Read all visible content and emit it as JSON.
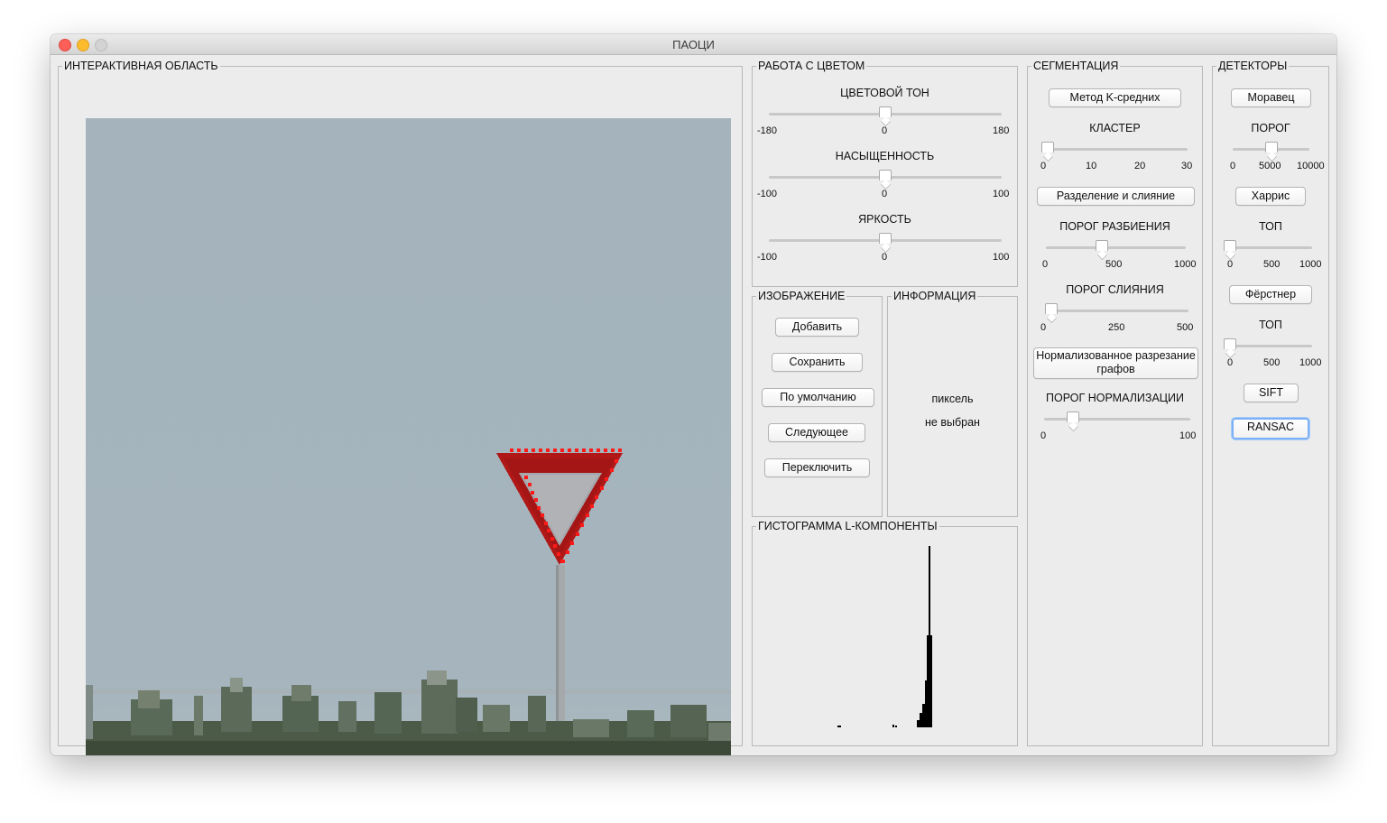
{
  "window": {
    "title": "ПАОЦИ"
  },
  "interactive": {
    "title": "ИНТЕРАКТИВНАЯ ОБЛАСТЬ"
  },
  "color": {
    "title": "РАБОТА С ЦВЕТОМ",
    "hue": {
      "label": "ЦВЕТОВОЙ ТОН",
      "min": "-180",
      "mid": "0",
      "max": "180",
      "value": 0,
      "range": [
        -180,
        180
      ]
    },
    "saturation": {
      "label": "НАСЫЩЕННОСТЬ",
      "min": "-100",
      "mid": "0",
      "max": "100",
      "value": 0,
      "range": [
        -100,
        100
      ]
    },
    "brightness": {
      "label": "ЯРКОСТЬ",
      "min": "-100",
      "mid": "0",
      "max": "100",
      "value": 0,
      "range": [
        -100,
        100
      ]
    }
  },
  "image": {
    "title": "ИЗОБРАЖЕНИЕ",
    "buttons": [
      "Добавить",
      "Сохранить",
      "По умолчанию",
      "Следующее",
      "Переключить"
    ]
  },
  "info": {
    "title": "ИНФОРМАЦИЯ",
    "line1": "пиксель",
    "line2": "не выбран"
  },
  "histogram": {
    "title": "ГИСТОГРАММА L-КОМПОНЕНТЫ"
  },
  "segmentation": {
    "title": "СЕГМЕНТАЦИЯ",
    "kmeans_button": "Метод K-средних",
    "cluster": {
      "label": "КЛАСТЕР",
      "ticks": [
        "0",
        "10",
        "20",
        "30"
      ],
      "value": 0,
      "range": [
        0,
        30
      ]
    },
    "split_merge_button": "Разделение и слияние",
    "split_threshold": {
      "label": "ПОРОГ РАЗБИЕНИЯ",
      "ticks": [
        "0",
        "500",
        "1000"
      ],
      "value": 400,
      "range": [
        0,
        1000
      ]
    },
    "merge_threshold": {
      "label": "ПОРОГ СЛИЯНИЯ",
      "ticks": [
        "0",
        "250",
        "500"
      ],
      "value": 20,
      "range": [
        0,
        500
      ]
    },
    "ncut_button": "Нормализованное разрезание графов",
    "norm_threshold": {
      "label": "ПОРОГ НОРМАЛИЗАЦИИ",
      "ticks": [
        "0",
        "100"
      ],
      "value": 20,
      "range": [
        0,
        100
      ]
    }
  },
  "detectors": {
    "title": "ДЕТЕКТОРЫ",
    "moravec_button": "Моравец",
    "threshold": {
      "label": "ПОРОГ",
      "ticks": [
        "0",
        "5000",
        "10000"
      ],
      "value": 5000,
      "range": [
        0,
        10000
      ]
    },
    "harris_button": "Харрис",
    "harris_top": {
      "label": "ТОП",
      "ticks": [
        "0",
        "500",
        "1000"
      ],
      "value": 0,
      "range": [
        0,
        1000
      ]
    },
    "forstner_button": "Фёрстнер",
    "forstner_top": {
      "label": "ТОП",
      "ticks": [
        "0",
        "500",
        "1000"
      ],
      "value": 0,
      "range": [
        0,
        1000
      ]
    },
    "sift_button": "SIFT",
    "ransac_button": "RANSAC"
  },
  "colors": {
    "sky": "#a3b3bd",
    "sign_red": "#b41818",
    "marker": "#ff0000",
    "focus": "#7db1f5"
  }
}
